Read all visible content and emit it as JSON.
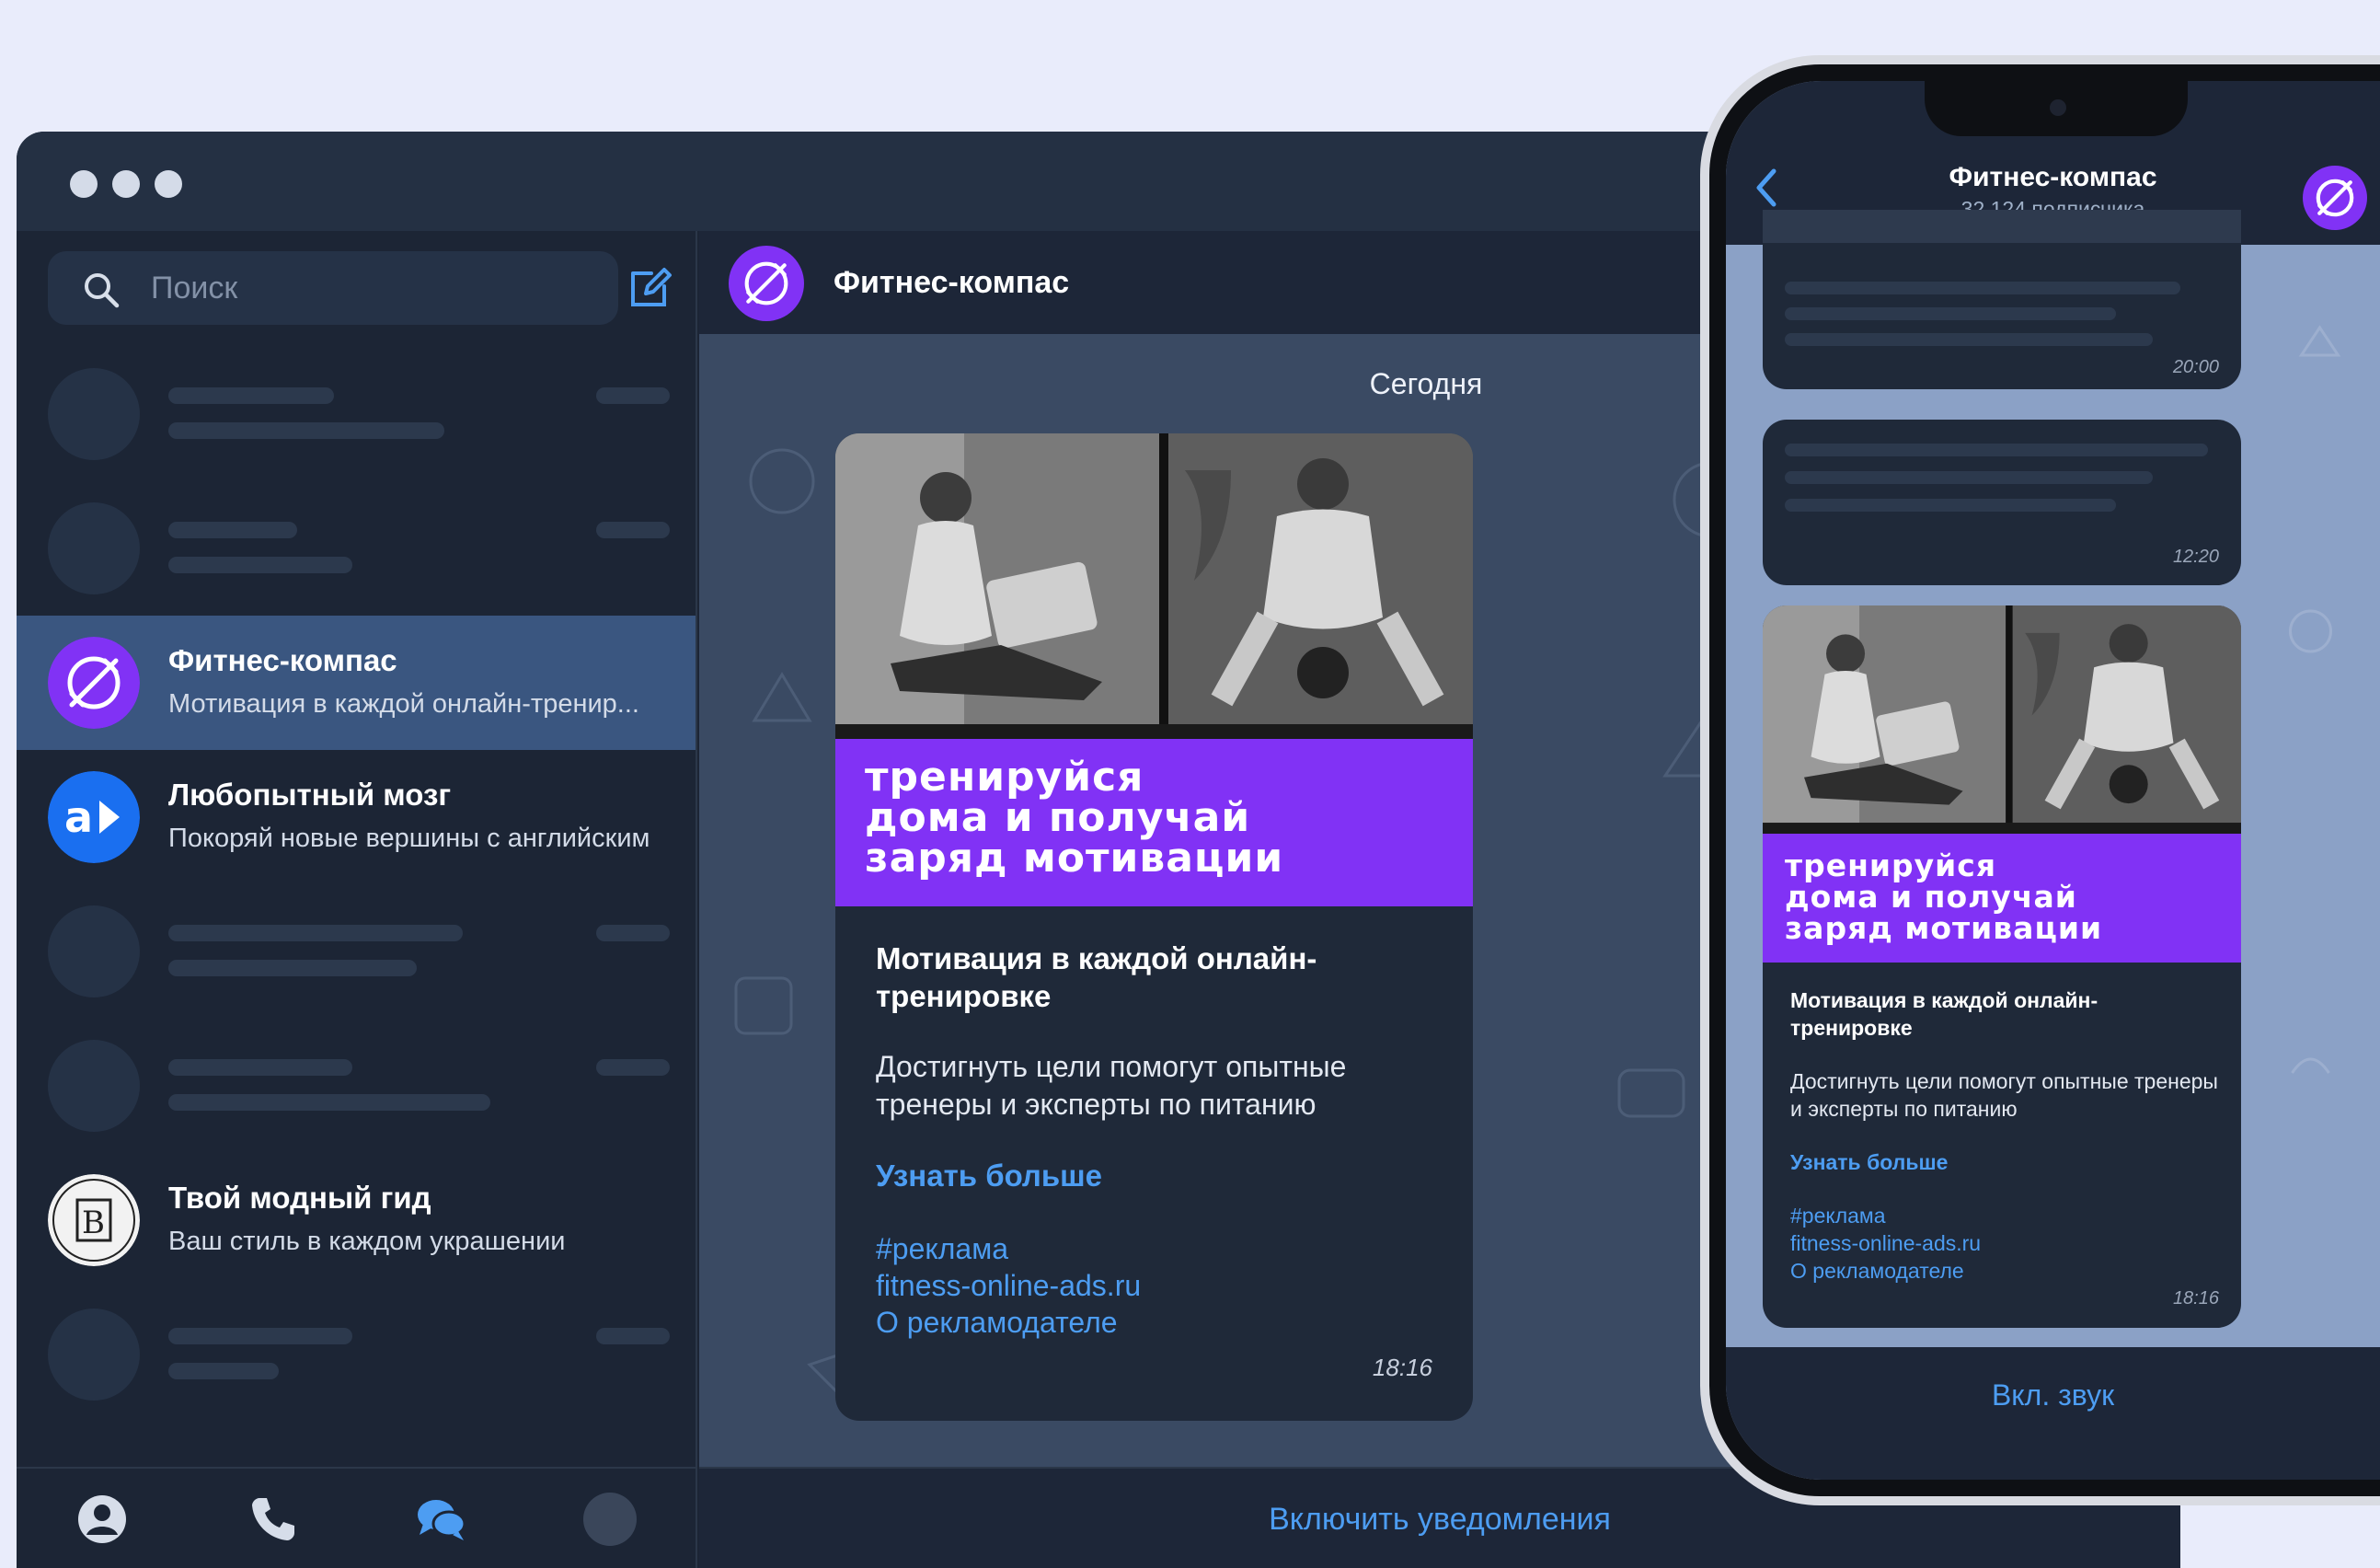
{
  "window": {
    "search_placeholder": "Поиск",
    "chats": [
      {
        "name": "Фитнес-компас",
        "preview": "Мотивация в каждой онлайн-тренир..."
      },
      {
        "name": "Любопытный мозг",
        "preview": "Покоряй новые вершины с английским"
      },
      {
        "name": "Твой модный гид",
        "preview": "Ваш стиль в каждом украшении"
      }
    ],
    "chat_title": "Фитнес-компас",
    "date_separator": "Сегодня",
    "footer_button": "Включить уведомления"
  },
  "post": {
    "banner_lines": [
      "тренируйся",
      "дома и получай",
      "заряд мотивации"
    ],
    "title": "Мотивация в каждой онлайн-тренировке",
    "body": "Достигнуть цели помогут опытные тренеры и эксперты по питанию",
    "link": "Узнать больше",
    "hashtag": "#реклама",
    "site": "fitness-online-ads.ru",
    "advertiser": "О рекламодателе",
    "time": "18:16"
  },
  "phone": {
    "title": "Фитнес-компас",
    "subscribers": "32 124 подписчика",
    "bubble_times": [
      "20:00",
      "12:20"
    ],
    "footer_button": "Вкл. звук"
  },
  "colors": {
    "accent": "#8132f5",
    "link": "#4d9df2",
    "active_row": "#3a5680",
    "window_bg": "#1c2535"
  },
  "icons": [
    "search-icon",
    "compose-icon",
    "profile-icon",
    "phone-icon",
    "chats-icon",
    "back-icon",
    "fitness-logo-icon"
  ]
}
